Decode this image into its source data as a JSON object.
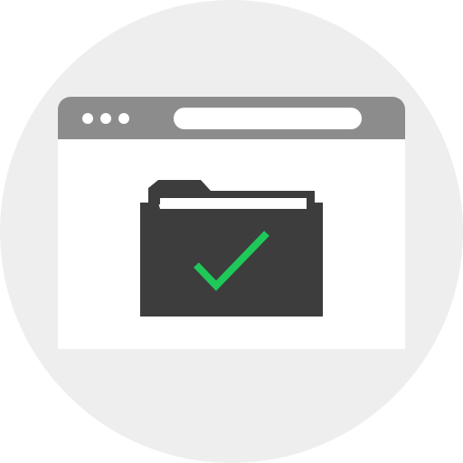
{
  "colors": {
    "background_circle": "#eeeeee",
    "browser_chrome": "#8c8c8c",
    "window_body": "#ffffff",
    "folder": "#3d3d3d",
    "paper": "#ffffff",
    "checkmark": "#1ec95a"
  },
  "icons": {
    "window_controls": "three-dots",
    "main": "folder-icon",
    "status": "checkmark-icon"
  }
}
